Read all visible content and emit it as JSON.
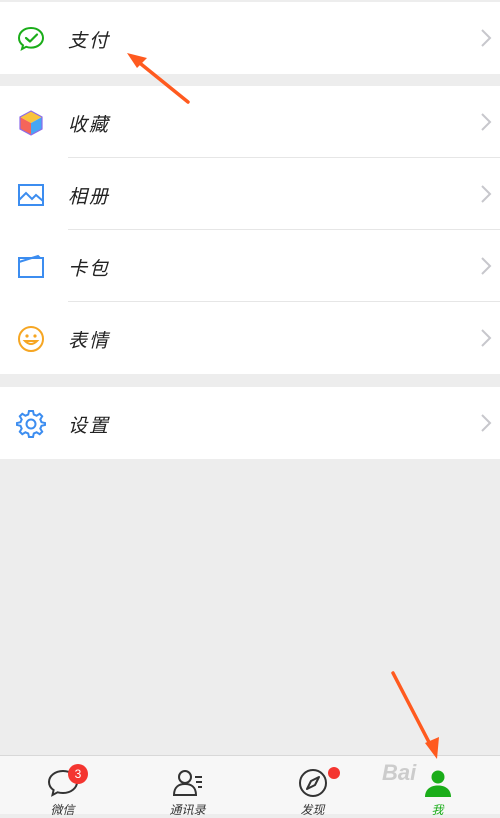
{
  "menu": {
    "pay": {
      "label": "支付",
      "icon": "wechat-pay-icon"
    },
    "favorites": {
      "label": "收藏",
      "icon": "cube-icon"
    },
    "album": {
      "label": "相册",
      "icon": "picture-icon"
    },
    "cards": {
      "label": "卡包",
      "icon": "wallet-icon"
    },
    "stickers": {
      "label": "表情",
      "icon": "smiley-icon"
    },
    "settings": {
      "label": "设置",
      "icon": "gear-icon"
    }
  },
  "tabbar": {
    "chats": {
      "label": "微信",
      "badge": "3",
      "icon": "chat-bubble-icon"
    },
    "contacts": {
      "label": "通讯录",
      "icon": "contacts-icon"
    },
    "discover": {
      "label": "发现",
      "icon": "compass-icon"
    },
    "me": {
      "label": "我",
      "icon": "person-icon"
    }
  },
  "watermark": {
    "text": "Bai"
  },
  "colors": {
    "accent_green": "#1aad19",
    "badge_red": "#f43530",
    "annotation_orange": "#ff5a1f",
    "background": "#ededed"
  }
}
